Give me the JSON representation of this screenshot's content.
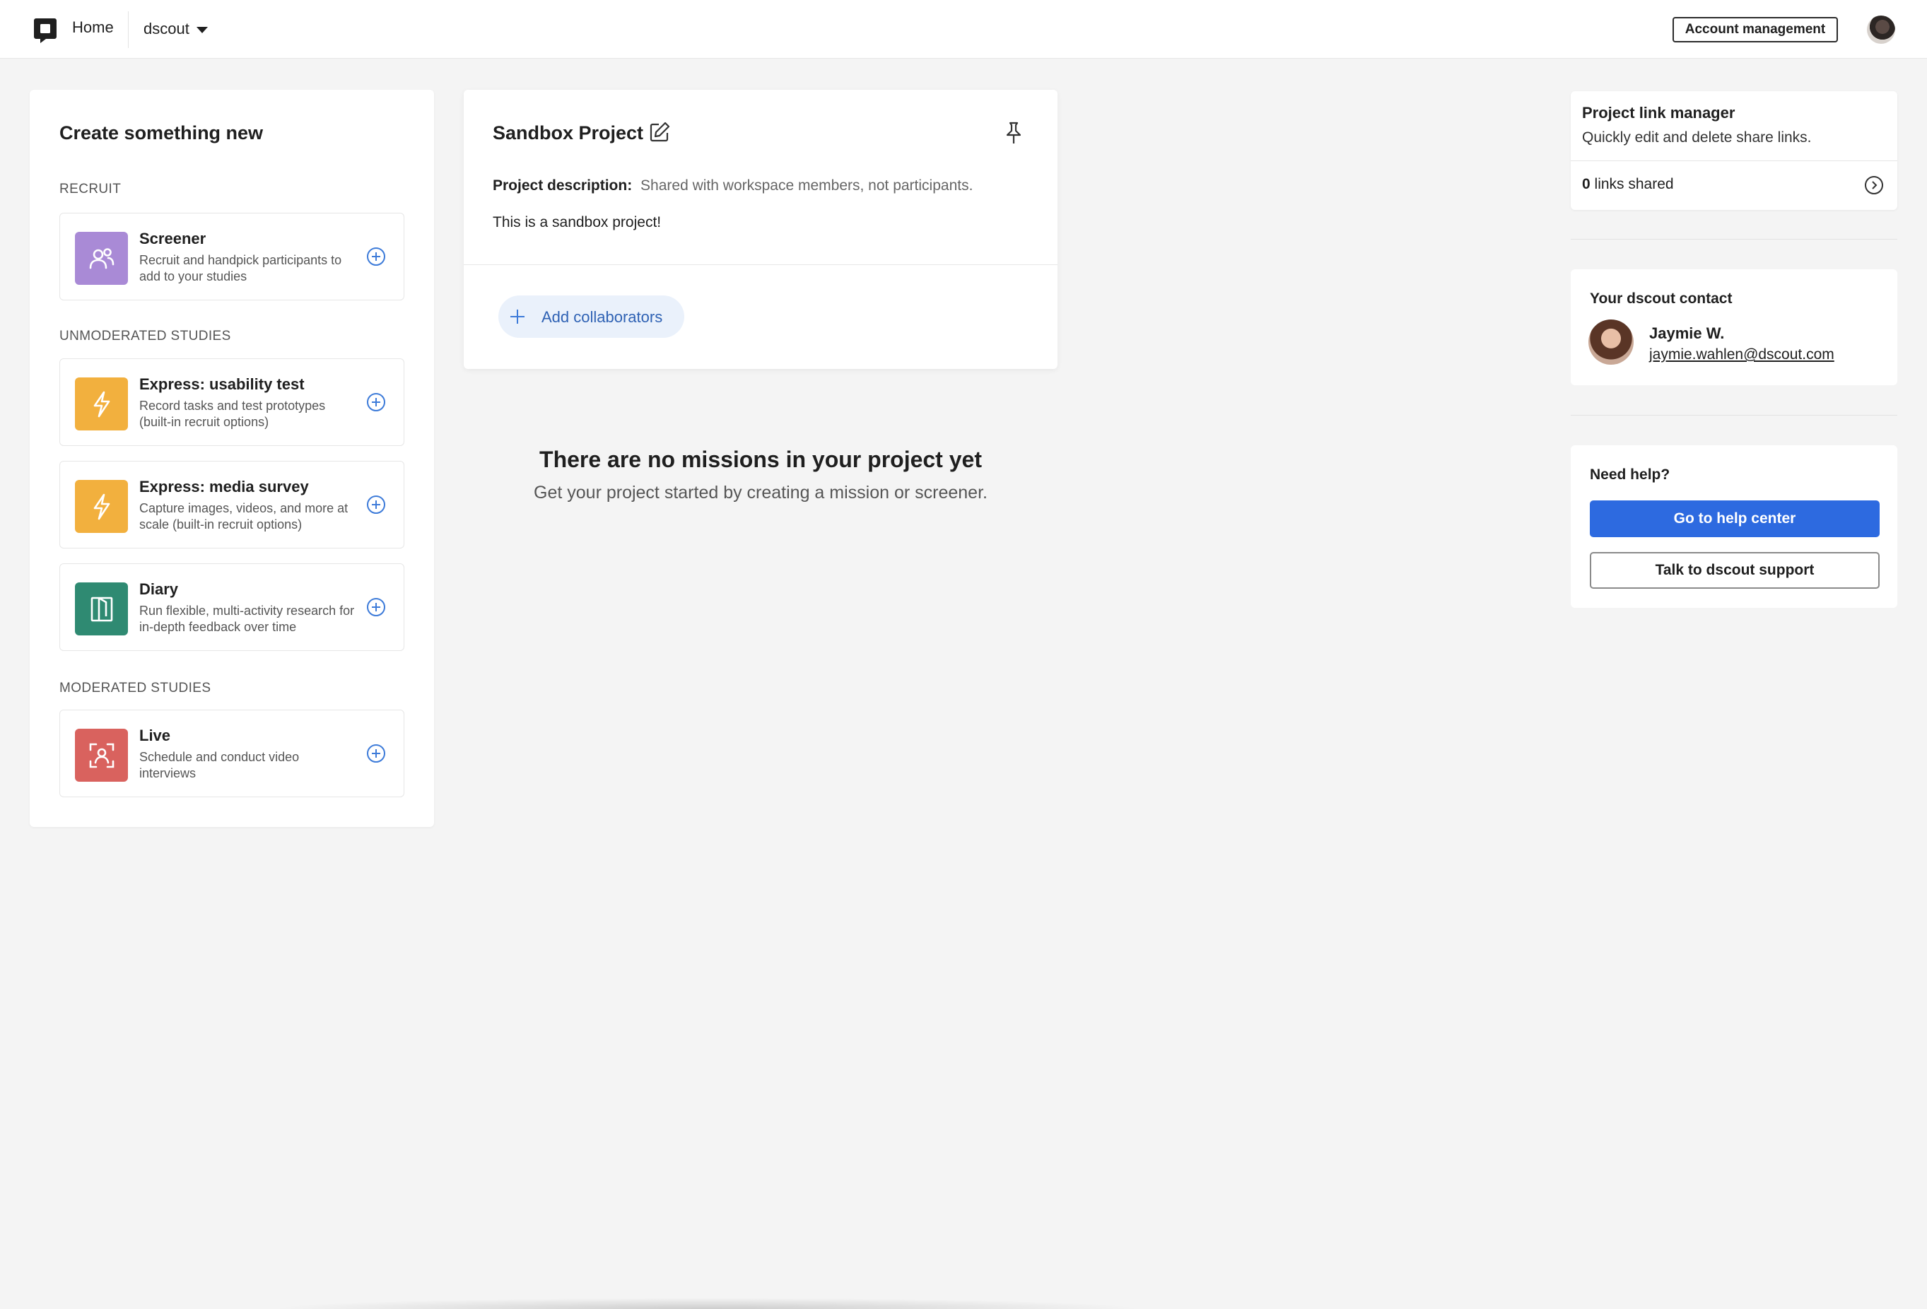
{
  "nav": {
    "home_label": "Home",
    "workspace_label": "dscout",
    "account_button": "Account management"
  },
  "create_panel": {
    "title": "Create something new",
    "sections": [
      {
        "label": "RECRUIT",
        "items": [
          {
            "title": "Screener",
            "description": "Recruit and handpick participants to add to your studies",
            "icon": "people-icon",
            "color": "#a98ad6"
          }
        ]
      },
      {
        "label": "UNMODERATED STUDIES",
        "items": [
          {
            "title": "Express: usability test",
            "description": "Record tasks and test prototypes (built-in recruit options)",
            "icon": "lightning-icon",
            "color": "#f2b03e"
          },
          {
            "title": "Express: media survey",
            "description": "Capture images, videos, and more at scale (built-in recruit options)",
            "icon": "lightning-icon",
            "color": "#f2b03e"
          },
          {
            "title": "Diary",
            "description": "Run flexible, multi-activity research for in-depth feedback over time",
            "icon": "diary-icon",
            "color": "#2f8a72"
          }
        ]
      },
      {
        "label": "MODERATED STUDIES",
        "items": [
          {
            "title": "Live",
            "description": "Schedule and conduct video interviews",
            "icon": "live-video-icon",
            "color": "#d9625e"
          }
        ]
      }
    ]
  },
  "project": {
    "title": "Sandbox Project",
    "description_label": "Project description:",
    "description_help": "Shared with workspace members, not participants.",
    "description_body": "This is a sandbox project!",
    "add_collaborators": "Add collaborators"
  },
  "empty_state": {
    "title": "There are no missions in your project yet",
    "subtitle": "Get your project started by creating a mission or screener."
  },
  "link_manager": {
    "title": "Project link manager",
    "subtitle": "Quickly edit and delete share links.",
    "count": "0",
    "count_suffix": "links shared"
  },
  "contact": {
    "title": "Your dscout contact",
    "name": "Jaymie W.",
    "email": "jaymie.wahlen@dscout.com"
  },
  "help": {
    "title": "Need help?",
    "primary_button": "Go to help center",
    "secondary_button": "Talk to dscout support"
  },
  "colors": {
    "accent_blue": "#2d6ae0",
    "link_blue": "#2f62b4"
  }
}
